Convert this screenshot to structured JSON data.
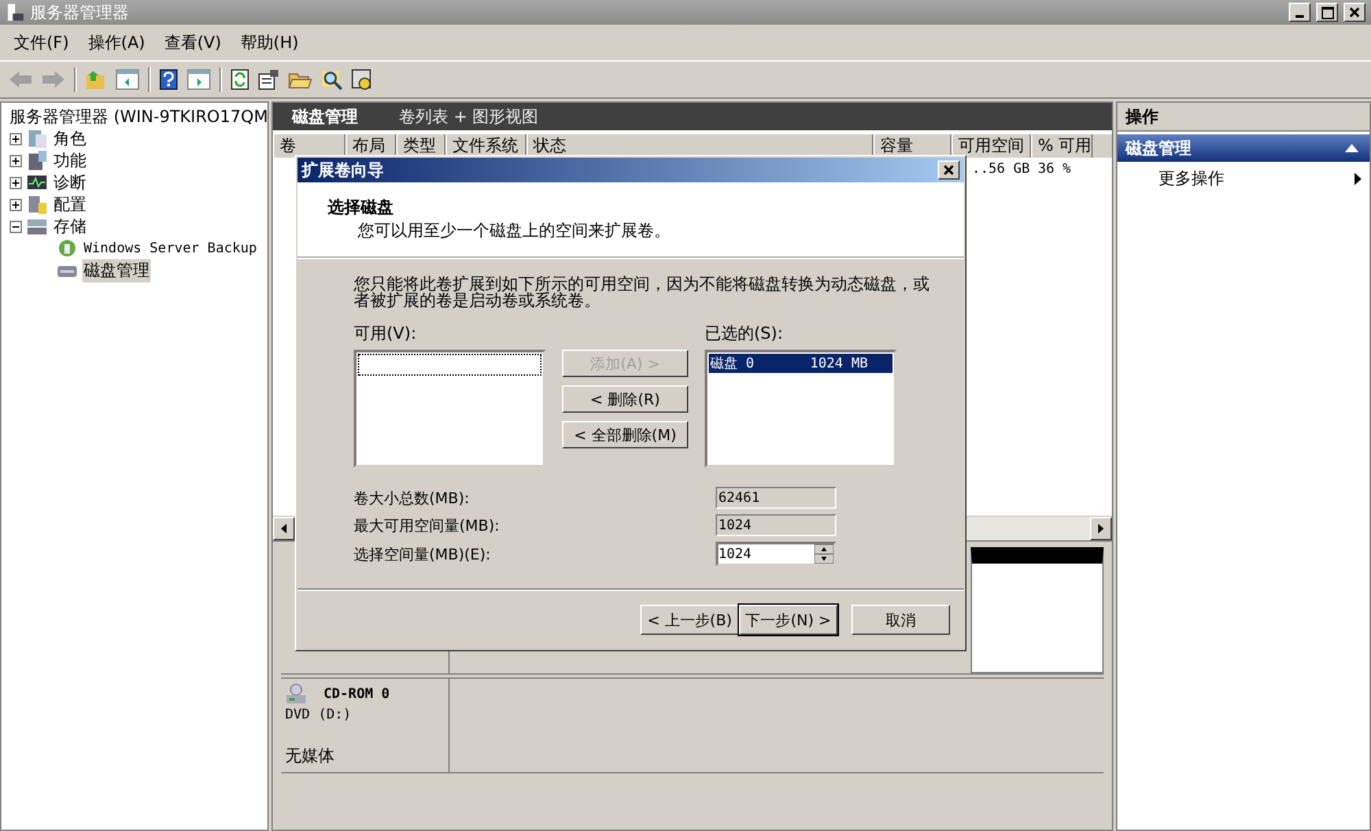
{
  "window": {
    "title": "服务器管理器"
  },
  "menu": [
    "文件(F)",
    "操作(A)",
    "查看(V)",
    "帮助(H)"
  ],
  "tree": [
    {
      "label": "服务器管理器 (WIN-9TKIRO17QM",
      "selected": false,
      "children": [
        {
          "label": "角色",
          "expanded": false,
          "selected": false
        },
        {
          "label": "功能",
          "expanded": false,
          "selected": false
        },
        {
          "label": "诊断",
          "expanded": false,
          "selected": false
        },
        {
          "label": "配置",
          "expanded": false,
          "selected": false
        },
        {
          "label": "存储",
          "expanded": true,
          "selected": false,
          "children": [
            {
              "label": "Windows Server Backup",
              "selected": false
            },
            {
              "label": "磁盘管理",
              "selected": true
            }
          ]
        }
      ]
    }
  ],
  "center": {
    "title": "磁盘管理",
    "view": "卷列表 + 图形视图",
    "columns": [
      "卷",
      "布局",
      "类型",
      "文件系统",
      "状态",
      "容量",
      "可用空间",
      "% 可用"
    ],
    "rows": [
      {
        "free_space": "..56 GB",
        "percent_free": "36 %"
      }
    ],
    "disks": [
      {
        "name": "CD-ROM 0",
        "type": "DVD (D:)",
        "status": "无媒体"
      }
    ]
  },
  "actions": {
    "title": "操作",
    "section": "磁盘管理",
    "items": [
      "更多操作"
    ]
  },
  "dialog": {
    "title": "扩展卷向导",
    "heading": "选择磁盘",
    "subheading": "您可以用至少一个磁盘上的空间来扩展卷。",
    "note": "您只能将此卷扩展到如下所示的可用空间，因为不能将磁盘转换为动态磁盘，或者被扩展的卷是启动卷或系统卷。",
    "available_label": "可用(V):",
    "selected_label": "已选的(S):",
    "selected_items": [
      {
        "disk": "磁盘 0",
        "size": "1024 MB",
        "selected": true
      }
    ],
    "buttons": [
      {
        "label": "添加(A) >",
        "disabled": true
      },
      {
        "label": "< 删除(R)",
        "disabled": false
      },
      {
        "label": "< 全部删除(M)",
        "disabled": false
      }
    ],
    "fields": [
      {
        "label": "卷大小总数(MB):",
        "value": "62461",
        "kind": "readonly"
      },
      {
        "label": "最大可用空间量(MB):",
        "value": "1024",
        "kind": "readonly"
      },
      {
        "label": "选择空间量(MB)(E):",
        "value": "1024",
        "kind": "spin"
      }
    ],
    "footer": [
      {
        "label": "< 上一步(B)",
        "default": false
      },
      {
        "label": "下一步(N) >",
        "default": true
      },
      {
        "label": "取消",
        "default": false
      }
    ]
  }
}
